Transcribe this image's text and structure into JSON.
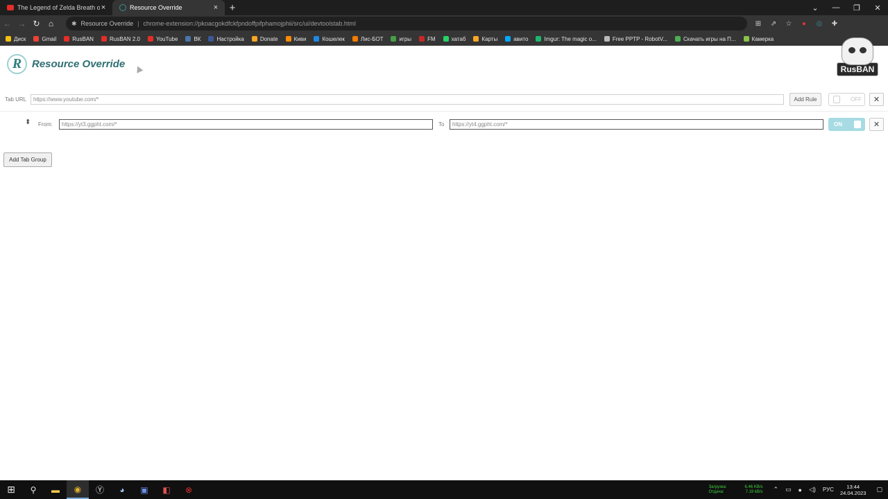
{
  "browser": {
    "tabs": [
      {
        "title": "The Legend of Zelda Breath of th",
        "close": "×"
      },
      {
        "title": "Resource Override",
        "close": "×"
      }
    ],
    "new_tab": "+",
    "window_controls": [
      "⌄",
      "—",
      "❐",
      "✕"
    ],
    "nav": {
      "back": "←",
      "forward": "→",
      "reload": "↻",
      "home": "⌂"
    },
    "omnibox": {
      "site": "Resource Override",
      "separator": "|",
      "url": "chrome-extension://pkoacgokdfckfpndoffpifphamojphii/src/ui/devtoolstab.html"
    },
    "bookmarks": [
      {
        "label": "Диск",
        "color": "#f4c20d"
      },
      {
        "label": "Gmail",
        "color": "#ea4335"
      },
      {
        "label": "RusBAN",
        "color": "#e52d27"
      },
      {
        "label": "RusBAN 2.0",
        "color": "#e52d27"
      },
      {
        "label": "YouTube",
        "color": "#e52d27"
      },
      {
        "label": "ВК",
        "color": "#4a76a8"
      },
      {
        "label": "Настройка",
        "color": "#3b5998"
      },
      {
        "label": "Donate",
        "color": "#f5a623"
      },
      {
        "label": "Киви",
        "color": "#ff8c00"
      },
      {
        "label": "Кошелек",
        "color": "#1e88e5"
      },
      {
        "label": "Лис-БОТ",
        "color": "#f57c00"
      },
      {
        "label": "игры",
        "color": "#43a047"
      },
      {
        "label": "FM",
        "color": "#c62828"
      },
      {
        "label": "хатаб",
        "color": "#25d366"
      },
      {
        "label": "Карты",
        "color": "#f9a825"
      },
      {
        "label": "авито",
        "color": "#00aaff"
      },
      {
        "label": "Imgur: The magic o...",
        "color": "#1bb76e"
      },
      {
        "label": "Free PPTP - RobotV...",
        "color": "#bbbbbb"
      },
      {
        "label": "Скачать игры на П...",
        "color": "#4caf50"
      },
      {
        "label": "Камерка",
        "color": "#8bc34a"
      }
    ]
  },
  "app": {
    "title": "Resource Override",
    "logo_letter": "R",
    "badge": "RusBAN",
    "tab_group": {
      "tab_url_label": "Tab URL",
      "tab_url_value": "https://www.youtube.com/*",
      "add_rule": "Add Rule",
      "toggle_label": "OFF",
      "remove": "✕"
    },
    "rule": {
      "sort": "⬍",
      "from_label": "From:",
      "from_value": "https://yt3.ggpht.com/*",
      "to_label": "To",
      "to_value": "https://yt4.ggpht.com/*",
      "toggle_label": "ON",
      "remove": "✕"
    },
    "add_tab_group": "Add Tab Group"
  },
  "taskbar": {
    "net": {
      "down_label": "Загрузка:",
      "up_label": "Отдача:",
      "down": "6.46 KB/s",
      "up": "7.19 kB/s"
    },
    "lang": "РУС",
    "time": "13:44",
    "date": "24.04.2023"
  },
  "colors": {
    "accent": "#2f6e72",
    "toggle_on": "#a7dbe4"
  }
}
